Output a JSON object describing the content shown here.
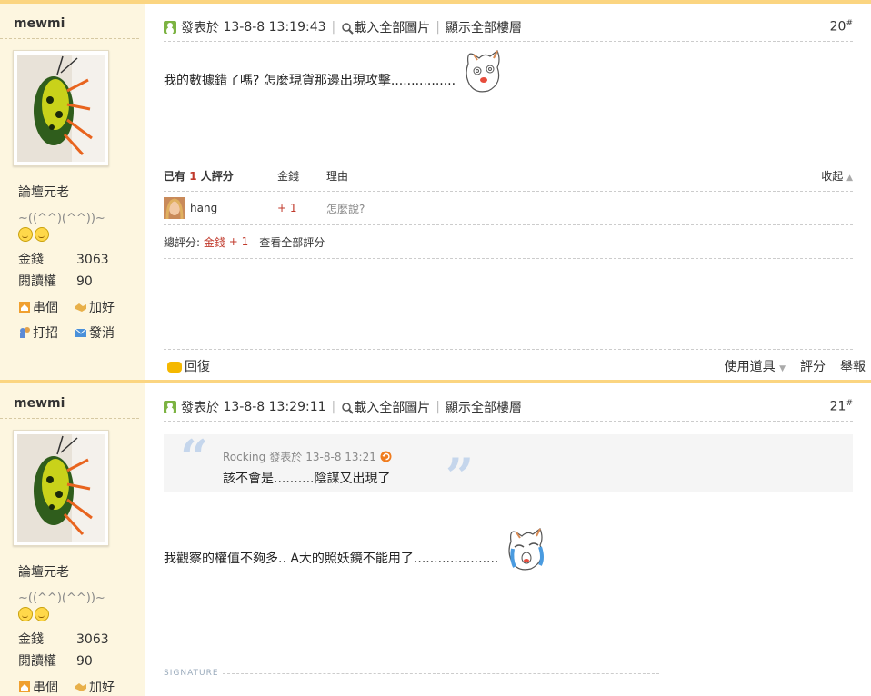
{
  "posts": [
    {
      "author": "mewmi",
      "rank": "論壇元老",
      "nickname": "~((^^)(^^))~",
      "stats": [
        {
          "k": "金錢",
          "v": "3063"
        },
        {
          "k": "閱讀權",
          "v": "90"
        }
      ],
      "actions": [
        "串個",
        "加好",
        "打招",
        "發消"
      ],
      "posted_label": "發表於",
      "posted_time": "13-8-8 13:19:43",
      "load_images": "載入全部圖片",
      "show_all_floors": "顯示全部樓層",
      "floor": "20",
      "message": "我的數據錯了嗎? 怎麼現貨那邊出現攻擊................",
      "rating": {
        "summary_prefix": "已有",
        "count": "1",
        "summary_suffix": "人評分",
        "col_money": "金錢",
        "col_reason": "理由",
        "collapse": "收起",
        "rows": [
          {
            "user": "hang",
            "value": "+ 1",
            "reason": "怎麼說?"
          }
        ],
        "total_label": "總評分:",
        "total_money_label": "金錢",
        "total_value": "+ 1",
        "view_all": "查看全部評分"
      },
      "footer": {
        "reply": "回復",
        "tools": "使用道具",
        "rate": "評分",
        "report": "舉報"
      }
    },
    {
      "author": "mewmi",
      "rank": "論壇元老",
      "nickname": "~((^^)(^^))~",
      "stats": [
        {
          "k": "金錢",
          "v": "3063"
        },
        {
          "k": "閱讀權",
          "v": "90"
        }
      ],
      "actions": [
        "串個",
        "加好"
      ],
      "posted_label": "發表於",
      "posted_time": "13-8-8 13:29:11",
      "load_images": "載入全部圖片",
      "show_all_floors": "顯示全部樓層",
      "floor": "21",
      "quote": {
        "author": "Rocking",
        "posted_label": "發表於",
        "time": "13-8-8 13:21",
        "text": "該不會是..........陰謀又出現了"
      },
      "message": "我觀察的權值不夠多.. A大的照妖鏡不能用了.....................",
      "signature": "SIGNATURE"
    }
  ]
}
